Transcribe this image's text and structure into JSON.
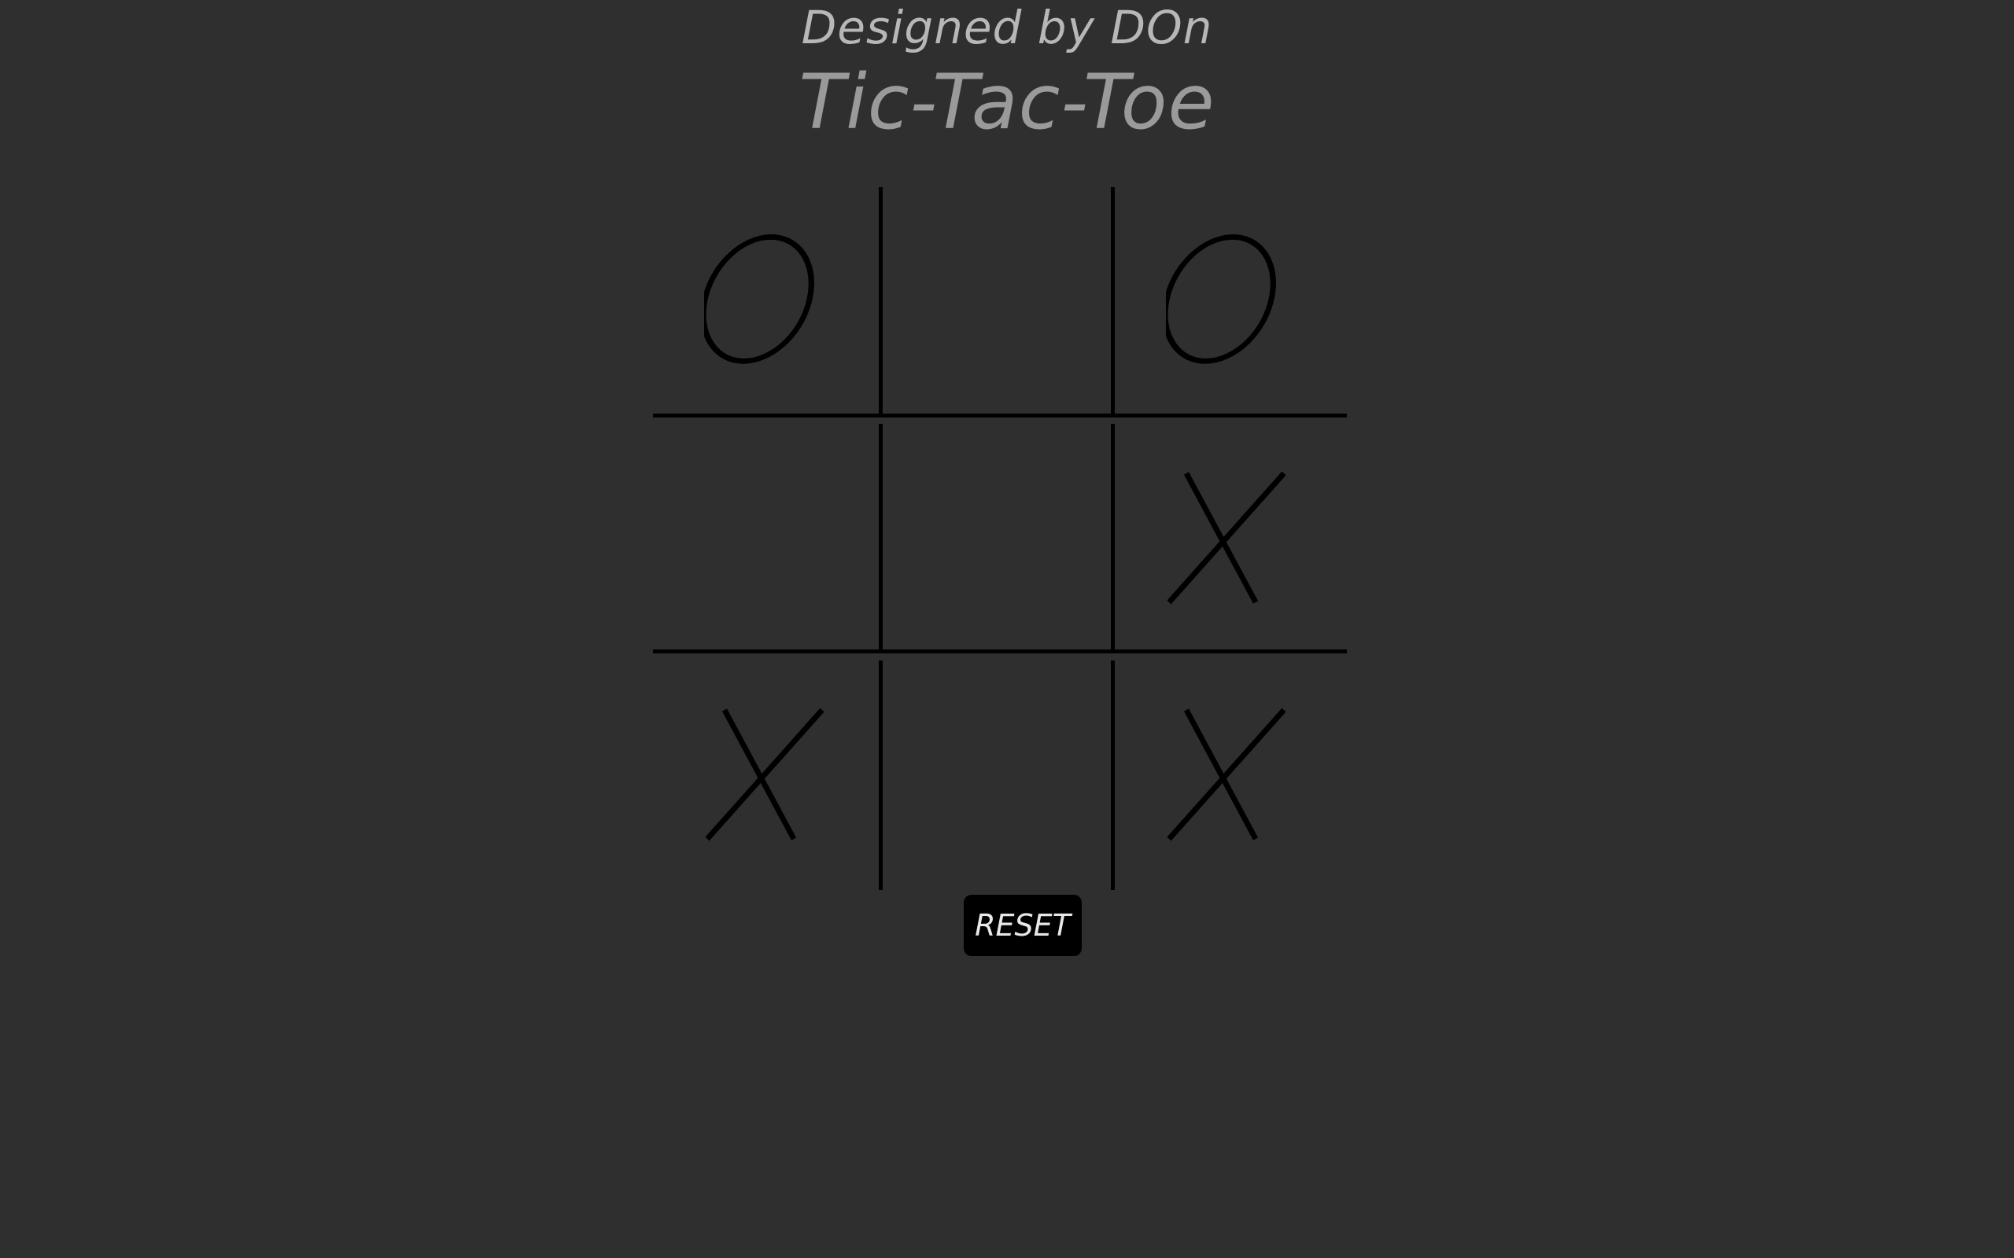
{
  "header": {
    "credit": "Designed by DOn",
    "title": "Tic-Tac-Toe"
  },
  "board": {
    "cells": [
      "O",
      "",
      "O",
      "",
      "",
      "X",
      "X",
      "",
      "X"
    ],
    "mark_color": "#000000",
    "line_color": "#000000"
  },
  "controls": {
    "reset_label": "RESET"
  },
  "colors": {
    "background": "#2f2f2f",
    "credit_text": "#b7b7b7",
    "title_text": "#9a9a9a",
    "button_bg": "#000000",
    "button_text": "#e8e8e8"
  }
}
